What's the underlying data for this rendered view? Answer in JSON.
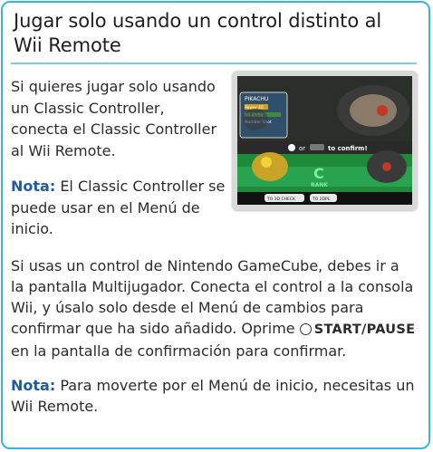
{
  "page": {
    "title_line1": "Jugar solo usando un control distinto al",
    "title_line2": "Wii Remote",
    "intro": [
      "Si quieres jugar solo usando",
      "un Classic Controller,",
      "conecta el Classic Controller",
      "al Wii Remote."
    ],
    "note1": {
      "label": "Nota:",
      "line1_rest": " El Classic Controller se",
      "line2": "puede usar en el Menú de",
      "line3": "inicio."
    },
    "gamecube": {
      "line1": "Si usas un control de Nintendo GameCube, debes ir a",
      "line2": "la pantalla Multijugador. Conecta el control a la consola",
      "line3": "Wii, y úsalo solo desde el Menú de cambios para",
      "line4_prefix": "confirmar que ha sido añadido. Oprime ",
      "button_label": "START/PAUSE",
      "line5": "en la pantalla de confirmación para confirmar."
    },
    "note2": {
      "label": "Nota:",
      "line1_rest": " Para moverte por el Menú de inicio, necesitas un",
      "line2": "Wii Remote."
    }
  },
  "screenshot": {
    "pokemon_name": "PIKACHU",
    "pokemon_stats": [
      "Power 40",
      "HP 47/50",
      "Number Shot"
    ],
    "confirm_text": "or",
    "confirm_text2": "to confirm!",
    "rank_letter": "C",
    "rank_word": "RANK",
    "bottom_left": "TO 3D CHECK",
    "bottom_right": "TO 2DPL"
  },
  "colors": {
    "border": "#39b3e3",
    "note_label": "#1d5aa8",
    "field_green": "#1f8a3a",
    "rank_green": "#2fae5a"
  }
}
